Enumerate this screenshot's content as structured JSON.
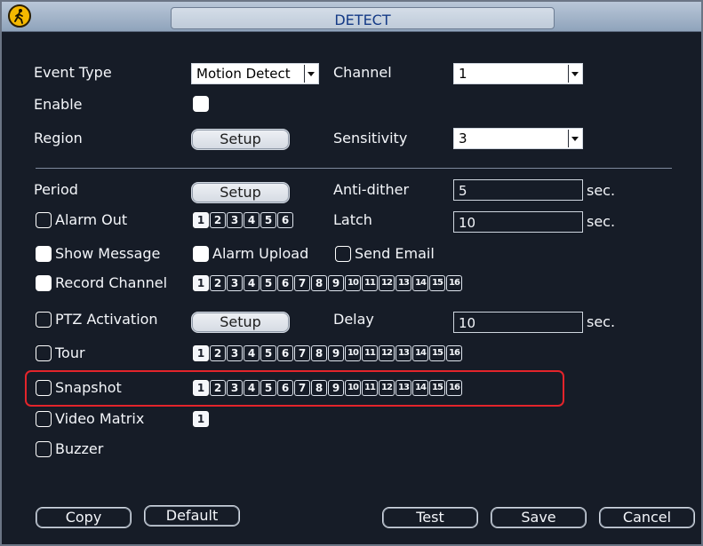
{
  "window": {
    "title": "DETECT",
    "icon": "walking-person-icon"
  },
  "colors": {
    "window_bg": "#161c27",
    "title_text": "#143a86",
    "highlight": "#e3242b",
    "icon_bg": "#f5b800"
  },
  "fields": {
    "event_type_label": "Event Type",
    "event_type_value": "Motion Detect",
    "channel_label": "Channel",
    "channel_value": "1",
    "enable_label": "Enable",
    "region_label": "Region",
    "region_button": "Setup",
    "sensitivity_label": "Sensitivity",
    "sensitivity_value": "3",
    "period_label": "Period",
    "period_button": "Setup",
    "anti_dither_label": "Anti-dither",
    "anti_dither_value": "5",
    "anti_dither_unit": "sec.",
    "alarm_out_label": "Alarm Out",
    "latch_label": "Latch",
    "latch_value": "10",
    "latch_unit": "sec.",
    "show_message_label": "Show Message",
    "alarm_upload_label": "Alarm Upload",
    "send_email_label": "Send Email",
    "record_channel_label": "Record Channel",
    "ptz_activation_label": "PTZ Activation",
    "ptz_button": "Setup",
    "delay_label": "Delay",
    "delay_value": "10",
    "delay_unit": "sec.",
    "tour_label": "Tour",
    "snapshot_label": "Snapshot",
    "video_matrix_label": "Video Matrix",
    "buzzer_label": "Buzzer"
  },
  "channel_numbers": [
    "1",
    "2",
    "3",
    "4",
    "5",
    "6",
    "7",
    "8",
    "9",
    "10",
    "11",
    "12",
    "13",
    "14",
    "15",
    "16"
  ],
  "alarm_out_numbers": [
    "1",
    "2",
    "3",
    "4",
    "5",
    "6"
  ],
  "video_matrix_numbers": [
    "1"
  ],
  "buttons": {
    "copy": "Copy",
    "default": "Default",
    "test": "Test",
    "save": "Save",
    "cancel": "Cancel"
  }
}
